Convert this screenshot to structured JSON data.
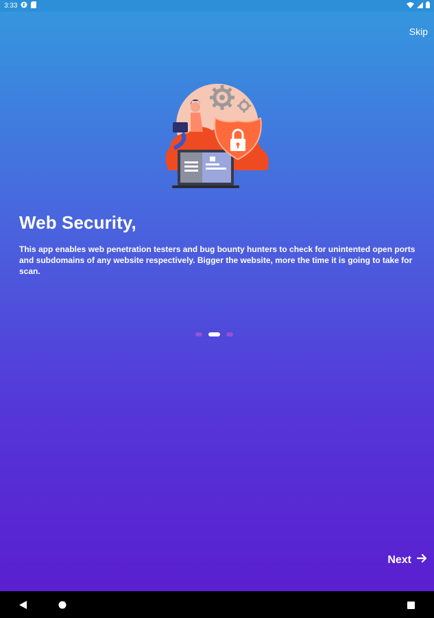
{
  "status_bar": {
    "time": "3:33",
    "icons": [
      "app-notification-icon",
      "sd-card-icon",
      "wifi-icon",
      "signal-icon",
      "battery-icon"
    ]
  },
  "onboarding": {
    "skip_label": "Skip",
    "title": "Web Security,",
    "description": "This app enables web penetration testers and bug bounty hunters to check for unintented open ports and subdomains of any website respectively. Bigger the website, more the time it is going to take for scan.",
    "page_indicator": {
      "total": 3,
      "current": 2
    },
    "next_label": "Next"
  },
  "nav_bar": {
    "buttons": [
      "back-icon",
      "home-icon",
      "recents-icon"
    ]
  },
  "colors": {
    "gradient_top": "#3596de",
    "gradient_bottom": "#5a1fd0",
    "illustration_accent": "#ff5a2c",
    "text": "#ffffff"
  }
}
